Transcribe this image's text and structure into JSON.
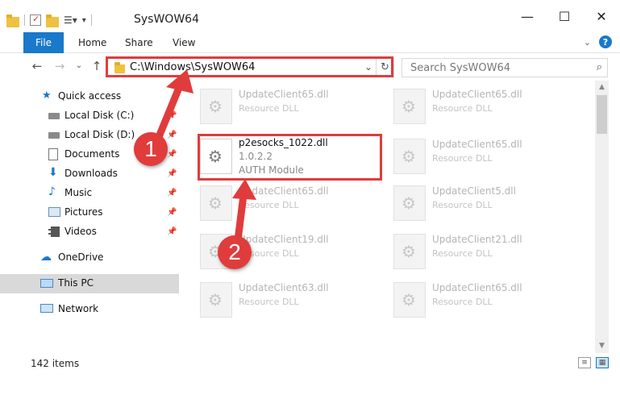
{
  "window": {
    "title": "SysWOW64"
  },
  "ribbon": {
    "tabs": [
      "File",
      "Home",
      "Share",
      "View"
    ]
  },
  "address": {
    "path": "C:\\Windows\\SysWOW64",
    "search_placeholder": "Search SysWOW64"
  },
  "sidebar": {
    "items": [
      {
        "label": "Quick access",
        "icon": "star-icon"
      },
      {
        "label": "Local Disk (C:)",
        "icon": "drive-icon"
      },
      {
        "label": "Local Disk (D:)",
        "icon": "drive-icon"
      },
      {
        "label": "Documents",
        "icon": "documents-icon"
      },
      {
        "label": "Downloads",
        "icon": "download-icon"
      },
      {
        "label": "Music",
        "icon": "music-icon"
      },
      {
        "label": "Pictures",
        "icon": "pictures-icon"
      },
      {
        "label": "Videos",
        "icon": "videos-icon"
      },
      {
        "label": "OneDrive",
        "icon": "cloud-icon"
      },
      {
        "label": "This PC",
        "icon": "pc-icon"
      },
      {
        "label": "Network",
        "icon": "network-icon"
      }
    ]
  },
  "files": [
    {
      "name": "UpdateClient65.dll",
      "desc": "Resource DLL"
    },
    {
      "name": "UpdateClient65.dll",
      "desc": "Resource DLL"
    },
    {
      "name": "p2esocks_1022.dll",
      "desc": "1.0.2.2",
      "desc2": "AUTH Module"
    },
    {
      "name": "UpdateClient65.dll",
      "desc": "Resource DLL"
    },
    {
      "name": "UpdateClient65.dll",
      "desc": "Resource DLL"
    },
    {
      "name": "UpdateClient5.dll",
      "desc": "Resource DLL"
    },
    {
      "name": "UpdateClient19.dll",
      "desc": "Resource DLL"
    },
    {
      "name": "UpdateClient21.dll",
      "desc": "Resource DLL"
    },
    {
      "name": "UpdateClient63.dll",
      "desc": "Resource DLL"
    },
    {
      "name": "UpdateClient65.dll",
      "desc": "Resource DLL"
    }
  ],
  "status": {
    "item_count": "142 items"
  },
  "annotations": {
    "step1": "1",
    "step2": "2",
    "color": "#e03c3c"
  }
}
